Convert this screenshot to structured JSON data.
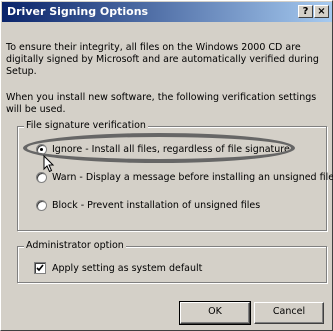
{
  "window": {
    "title": "Driver Signing Options",
    "help_button": "?",
    "close_button": "×"
  },
  "intro": {
    "paragraph1": "To ensure their integrity, all files on the Windows 2000 CD are digitally signed by Microsoft and are automatically verified during Setup.",
    "paragraph2": "When you install new software, the following verification settings will be used."
  },
  "file_signature": {
    "group_label": "File signature verification",
    "options": [
      {
        "label": "Ignore - Install all files, regardless of file signature",
        "checked": true
      },
      {
        "label": "Warn - Display a message before installing an unsigned file",
        "checked": false
      },
      {
        "label": "Block - Prevent installation of unsigned files",
        "checked": false
      }
    ]
  },
  "admin": {
    "group_label": "Administrator option",
    "checkbox_label": "Apply setting as system default",
    "checked": true
  },
  "buttons": {
    "ok": "OK",
    "cancel": "Cancel"
  },
  "colors": {
    "titlebar_start": "#0a246a",
    "titlebar_end": "#a6caf0",
    "face": "#d4d0c8",
    "annotation_ellipse": "#666666"
  },
  "icons": {
    "cursor": "arrow-cursor-icon"
  }
}
